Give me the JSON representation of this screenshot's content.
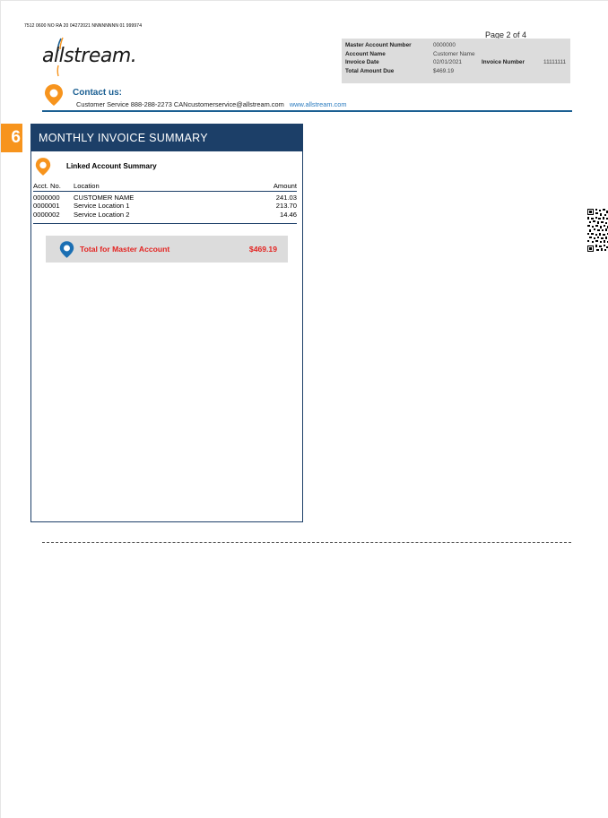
{
  "header": {
    "code_line": "7512 0600  NO RA 20 04272021 NNNNNNNN 01 999974",
    "logo_text": "allstream.",
    "page_number": "Page 2 of 4"
  },
  "account_box": {
    "master_account_number_label": "Master Account Number",
    "master_account_number": "0000000",
    "account_name_label": "Account Name",
    "account_name": "Customer Name",
    "invoice_date_label": "Invoice Date",
    "invoice_date": "02/01/2021",
    "invoice_number_label": "Invoice Number",
    "invoice_number": "11111111",
    "total_amount_due_label": "Total Amount Due",
    "total_amount_due": "$469.19"
  },
  "contact": {
    "title": "Contact us:",
    "line": "Customer  Service  888-288-2273  CANcustomerservice@allstream.com",
    "website": "www.allstream.com"
  },
  "summary": {
    "section_number": "6",
    "heading": "MONTHLY INVOICE SUMMARY",
    "linked_title": "Linked Account Summary",
    "columns": {
      "acct": "Acct. No.",
      "location": "Location",
      "amount": "Amount"
    },
    "rows": [
      {
        "acct": "0000000",
        "location": "CUSTOMER NAME",
        "amount": "241.03"
      },
      {
        "acct": "0000001",
        "location": "Service Location 1",
        "amount": "213.70"
      },
      {
        "acct": "0000002",
        "location": "Service Location 2",
        "amount": "14.46"
      }
    ],
    "total_label": "Total for Master Account",
    "total_amount": "$469.19"
  },
  "colors": {
    "navy": "#1c3f68",
    "orange": "#f7941d",
    "blue": "#1b5f92",
    "red": "#e32421",
    "grey_box": "#dcdcdc"
  },
  "icons": [
    "allstream-logo",
    "location-pin-icon",
    "qr-code"
  ]
}
